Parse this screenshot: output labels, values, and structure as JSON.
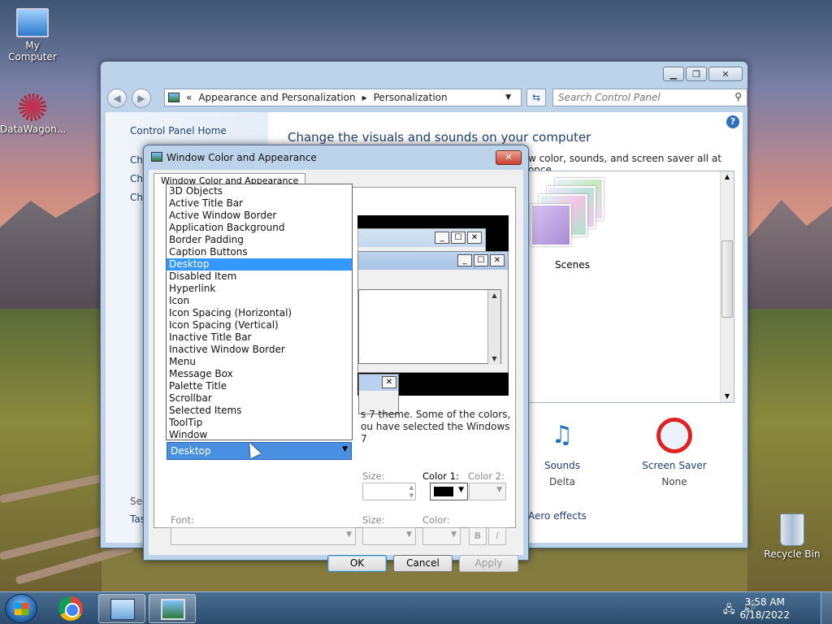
{
  "desktop": {
    "icons": [
      {
        "label": "My Computer"
      },
      {
        "label": "DataWagon..."
      },
      {
        "label": "Recycle Bin"
      }
    ]
  },
  "control_panel": {
    "breadcrumb_prefix": "«",
    "breadcrumb": [
      "Appearance and Personalization",
      "Personalization"
    ],
    "search_placeholder": "Search Control Panel",
    "left_pane": {
      "home": "Control Panel Home",
      "items": [
        "Ch",
        "Ch",
        "Ch"
      ],
      "see_also": "See",
      "taskbar": "Tas"
    },
    "heading": "Change the visuals and sounds on your computer",
    "subtext": "w color, sounds, and screen saver all at once.",
    "theme_label": "Scenes",
    "sounds": {
      "label": "Sounds",
      "value": "Delta"
    },
    "screen_saver": {
      "label": "Screen Saver",
      "value": "None"
    },
    "aero_link": "Aero effects"
  },
  "dialog": {
    "title": "Window Color and Appearance",
    "tab": "Window Color and Appearance",
    "preview_window_buttons": [
      "_",
      "☐",
      "✕"
    ],
    "description_lines": [
      "s 7 theme.  Some of the colors,",
      "ou have selected the Windows 7"
    ],
    "item_dropdown": {
      "selected": "Desktop",
      "options": [
        "3D Objects",
        "Active Title Bar",
        "Active Window Border",
        "Application Background",
        "Border Padding",
        "Caption Buttons",
        "Desktop",
        "Disabled Item",
        "Hyperlink",
        "Icon",
        "Icon Spacing (Horizontal)",
        "Icon Spacing (Vertical)",
        "Inactive Title Bar",
        "Inactive Window Border",
        "Menu",
        "Message Box",
        "Palette Title",
        "Scrollbar",
        "Selected Items",
        "ToolTip",
        "Window"
      ]
    },
    "size_label": "Size:",
    "color1_label": "Color 1:",
    "color2_label": "Color 2:",
    "color1_value": "#000000",
    "font_label": "Font:",
    "font_size_label": "Size:",
    "font_color_label": "Color:",
    "bold_label": "B",
    "italic_label": "I",
    "ok_label": "OK",
    "cancel_label": "Cancel",
    "apply_label": "Apply"
  },
  "taskbar": {
    "time": "3:58 AM",
    "date": "6/18/2022"
  }
}
